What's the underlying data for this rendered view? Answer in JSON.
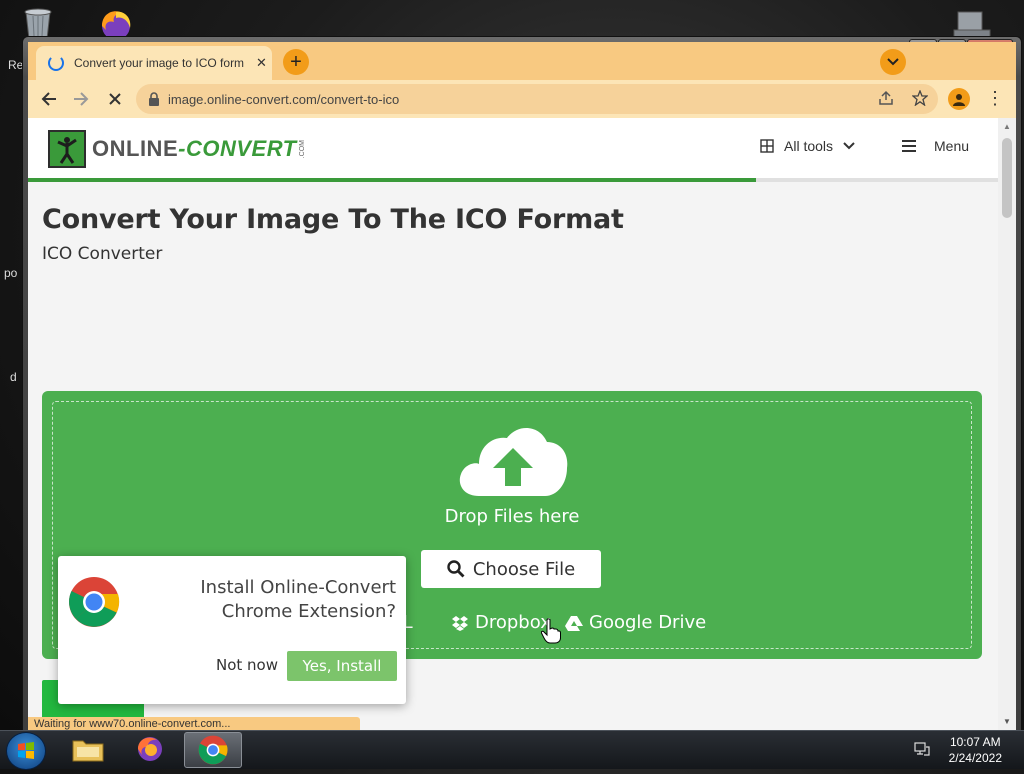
{
  "desktop": {
    "labels": [
      "Re",
      "po",
      "d"
    ]
  },
  "window": {
    "minimize": "▬",
    "maximize": "□",
    "close": "✕"
  },
  "browser": {
    "tab_title": "Convert your image to ICO form",
    "tab_close": "✕",
    "url": "image.online-convert.com/convert-to-ico",
    "status_text": "Waiting for www70.online-convert.com..."
  },
  "site": {
    "logo_text": "ONLINE-CONVERT",
    "logo_text_a": "ONLINE",
    "logo_text_dash": "-",
    "logo_text_b": "CONVERT",
    "logo_com": ".COM",
    "nav_all_tools": "All tools",
    "nav_menu": "Menu",
    "progress_fraction": 0.75
  },
  "main": {
    "title": "Convert Your Image To The ICO Format",
    "subtitle": "ICO Converter",
    "drop_text": "Drop Files here",
    "choose_file": "Choose File",
    "url_partial": "URL",
    "dropbox": "Dropbox",
    "google_drive": "Google Drive"
  },
  "popup": {
    "message": "Install Online-Convert Chrome Extension?",
    "not_now": "Not now",
    "yes_install": "Yes, Install"
  },
  "taskbar": {
    "time": "10:07 AM",
    "date": "2/24/2022"
  },
  "colors": {
    "brand_green": "#4caf50",
    "chrome_theme": "#f8c981",
    "install_green": "#7cc46b"
  }
}
